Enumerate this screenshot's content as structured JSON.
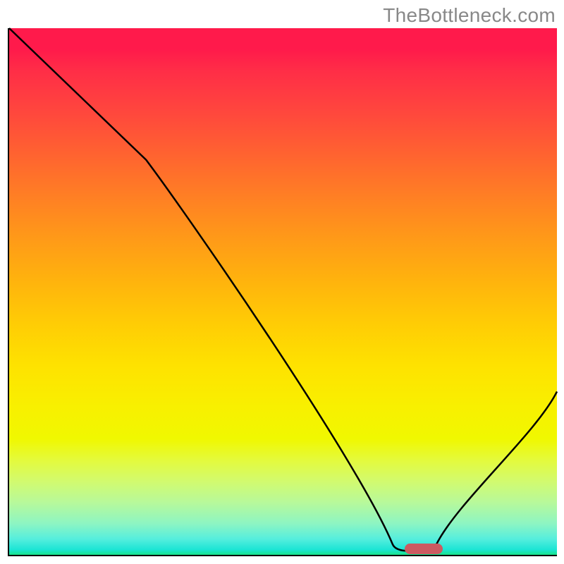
{
  "watermark": "TheBottleneck.com",
  "chart_data": {
    "type": "line",
    "title": "",
    "xlabel": "",
    "ylabel": "",
    "xlim": [
      0,
      100
    ],
    "ylim": [
      0,
      100
    ],
    "grid": false,
    "legend": false,
    "series": [
      {
        "name": "curve",
        "x": [
          0,
          25,
          70,
          78,
          100
        ],
        "values": [
          100,
          75,
          2,
          2,
          31
        ]
      }
    ],
    "marker": {
      "x_start": 72,
      "x_end": 79,
      "y": 1.5
    },
    "gradient_colors_top_to_bottom": [
      "#ff1a4b",
      "#ffcc05",
      "#19e38a"
    ],
    "curve_color": "#000000",
    "marker_color": "#cc5a61"
  }
}
